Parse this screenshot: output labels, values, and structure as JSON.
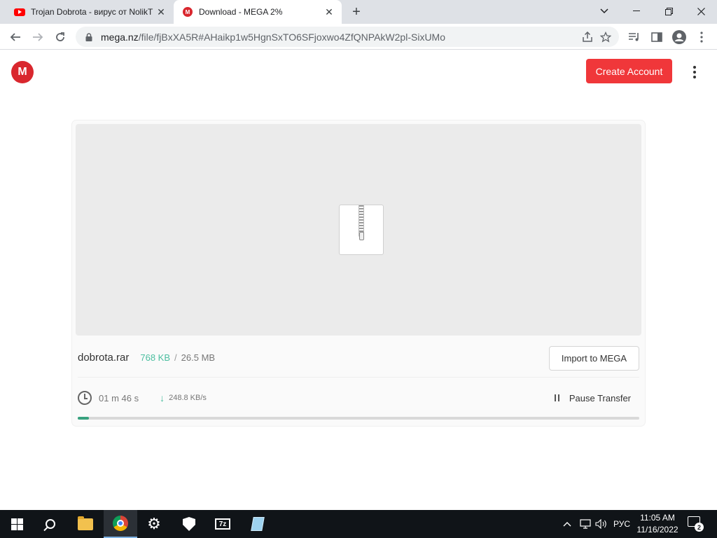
{
  "browser": {
    "tabs": [
      {
        "title": "Trojan Dobrota - вирус от NolikT",
        "icon": "youtube-icon",
        "active": false
      },
      {
        "title": "Download - MEGA 2%",
        "icon": "mega-icon",
        "active": true
      }
    ],
    "new_tab_label": "+",
    "window_controls": {
      "minimize": "—",
      "restore": "❐",
      "close": "✕",
      "tab_search": "⌄"
    },
    "address": {
      "host": "mega.nz",
      "path": "/file/fjBxXA5R#AHaikp1w5HgnSxTO6SFjoxwo4ZfQNPAkW2pl-SixUMo"
    }
  },
  "header": {
    "logo_letter": "M",
    "create_account_label": "Create Account"
  },
  "download": {
    "file_name": "dobrota.rar",
    "downloaded": "768 KB",
    "separator": "/",
    "total_size": "26.5 MB",
    "import_label": "Import to MEGA",
    "time_remaining": "01 m  46 s",
    "speed_arrow": "↓",
    "speed": "248.8 KB/s",
    "pause_label": "Pause Transfer",
    "progress_fraction": 0.02,
    "accent_color": "#38a27f"
  },
  "taskbar": {
    "items": [
      "start-icon",
      "search-icon",
      "file-explorer-icon",
      "chrome-icon",
      "settings-icon",
      "windows-security-icon",
      "7zip-icon",
      "notepad-icon"
    ],
    "sevenzip_label": "7z",
    "tray": {
      "chevron": "^",
      "language": "РУС",
      "time": "11:05 AM",
      "date": "11/16/2022",
      "notification_count": "2"
    }
  },
  "colors": {
    "mega_red": "#d9272e",
    "create_button": "#f0373a",
    "download_green": "#4cbfa0",
    "taskbar": "#101418"
  }
}
